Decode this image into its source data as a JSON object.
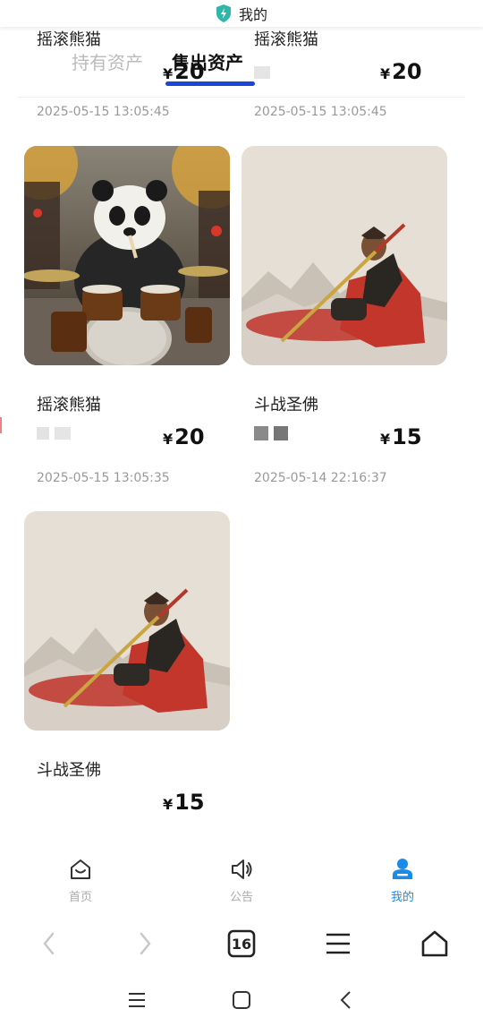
{
  "header": {
    "title": "我的"
  },
  "tabs": {
    "hold_label": "持有资产",
    "sold_label": "售出资产"
  },
  "cards": [
    {
      "name": "摇滚熊猫",
      "currency": "¥",
      "price": "20",
      "date": "2025-05-15 13:05:45"
    },
    {
      "name": "摇滚熊猫",
      "currency": "¥",
      "price": "20",
      "date": "2025-05-15 13:05:45"
    },
    {
      "name": "摇滚熊猫",
      "currency": "¥",
      "price": "20",
      "date": "2025-05-15 13:05:35"
    },
    {
      "name": "斗战圣佛",
      "currency": "¥",
      "price": "15",
      "date": "2025-05-14 22:16:37"
    },
    {
      "name": "斗战圣佛",
      "currency": "¥",
      "price": "15",
      "date": ""
    }
  ],
  "tabbar": {
    "items": [
      {
        "label": "首页",
        "icon": "home-smile-icon"
      },
      {
        "label": "公告",
        "icon": "speaker-icon"
      },
      {
        "label": "我的",
        "icon": "user-icon"
      }
    ],
    "active_color": "#1a8be6"
  },
  "browser": {
    "tab_count": "16"
  },
  "colors": {
    "accent": "#1a46d9",
    "inactive": "#aaaaaa"
  }
}
